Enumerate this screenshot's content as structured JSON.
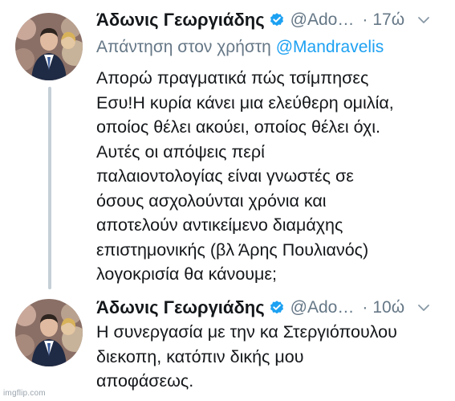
{
  "tweets": [
    {
      "author_name": "Άδωνις Γεωργιάδης",
      "handle": "@Ado…",
      "separator": "·",
      "time": "17ώ",
      "reply_prefix": "Απάντηση στον χρήστη",
      "reply_mention": "@Mandravelis",
      "body_lines": [
        "Απορώ πραγματικά πώς τσίμπησες",
        "Εσυ!Η κυρία κάνει μια ελεύθερη ομιλία,",
        "οποίος θέλει ακούει, οποίος θέλει όχι.",
        "Αυτές οι απόψεις περί",
        "παλαιοντολογίας είναι γνωστές σε",
        "όσους ασχολούνται χρόνια και",
        "αποτελούν αντικείμενο διαμάχης",
        "επιστημονικής (βλ Άρης Πουλιανός)",
        "λογοκρισία θα κάνουμε;"
      ]
    },
    {
      "author_name": "Άδωνις Γεωργιάδης",
      "handle": "@Ado…",
      "separator": "·",
      "time": "10ώ",
      "body_lines": [
        "Η συνεργασία με την κα Στεργιόπουλου",
        "διεκοπη, κατόπιν δικής μου",
        "αποφάσεως."
      ]
    }
  ],
  "watermark": "imgflip.com",
  "colors": {
    "text": "#14171a",
    "muted": "#657786",
    "link": "#1da1f2",
    "thread_line": "#c4cfd6",
    "verified_badge": "#1da1f2"
  },
  "icons": {
    "verified": "verified-badge-icon",
    "more": "chevron-down-icon",
    "avatar": "profile-photo"
  }
}
